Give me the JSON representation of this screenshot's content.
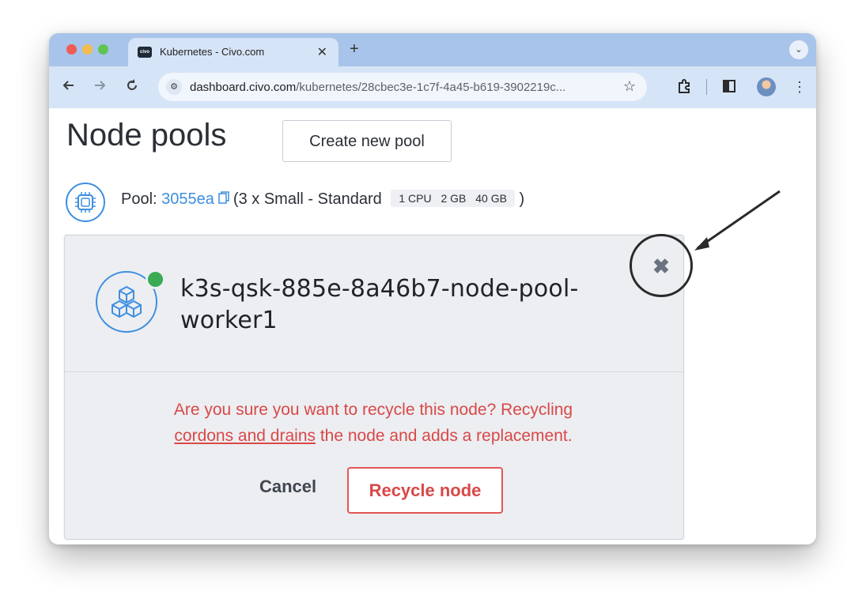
{
  "browser": {
    "tab_title": "Kubernetes - Civo.com",
    "tab_favicon_text": "civo",
    "tab_close": "✕",
    "new_tab": "+",
    "tab_menu": "⌄",
    "url_domain": "dashboard.civo.com",
    "url_path": "/kubernetes/28cbec3e-1c7f-4a45-b619-3902219c...",
    "icons": {
      "back": "back-arrow-icon",
      "forward": "forward-arrow-icon",
      "reload": "reload-icon",
      "site_info": "site-settings-icon",
      "bookmark": "star-icon",
      "extensions": "puzzle-icon",
      "side_panel": "side-panel-icon",
      "profile": "avatar-icon",
      "menu": "kebab-menu-icon"
    }
  },
  "page": {
    "title": "Node pools",
    "create_button": "Create new pool"
  },
  "pool": {
    "label": "Pool: ",
    "id": "3055ea",
    "description": " (3 x Small - Standard",
    "specs": [
      "1 CPU",
      "2 GB",
      "40 GB"
    ],
    "close_paren": " )"
  },
  "node": {
    "name": "k3s-qsk-885e-8a46b7-node-pool-worker1",
    "status": "running",
    "status_color": "#3aaa55",
    "close_symbol": "✖",
    "confirm_text_1": "Are you sure you want to recycle this node? Recycling",
    "confirm_link": "cordons and drains",
    "confirm_text_2": " the node and adds a replacement.",
    "cancel_label": "Cancel",
    "recycle_label": "Recycle node"
  },
  "colors": {
    "accent": "#3d8fe0",
    "danger": "#d94848",
    "tabbar": "#a9c4ea",
    "toolbar": "#d6e4f7"
  }
}
